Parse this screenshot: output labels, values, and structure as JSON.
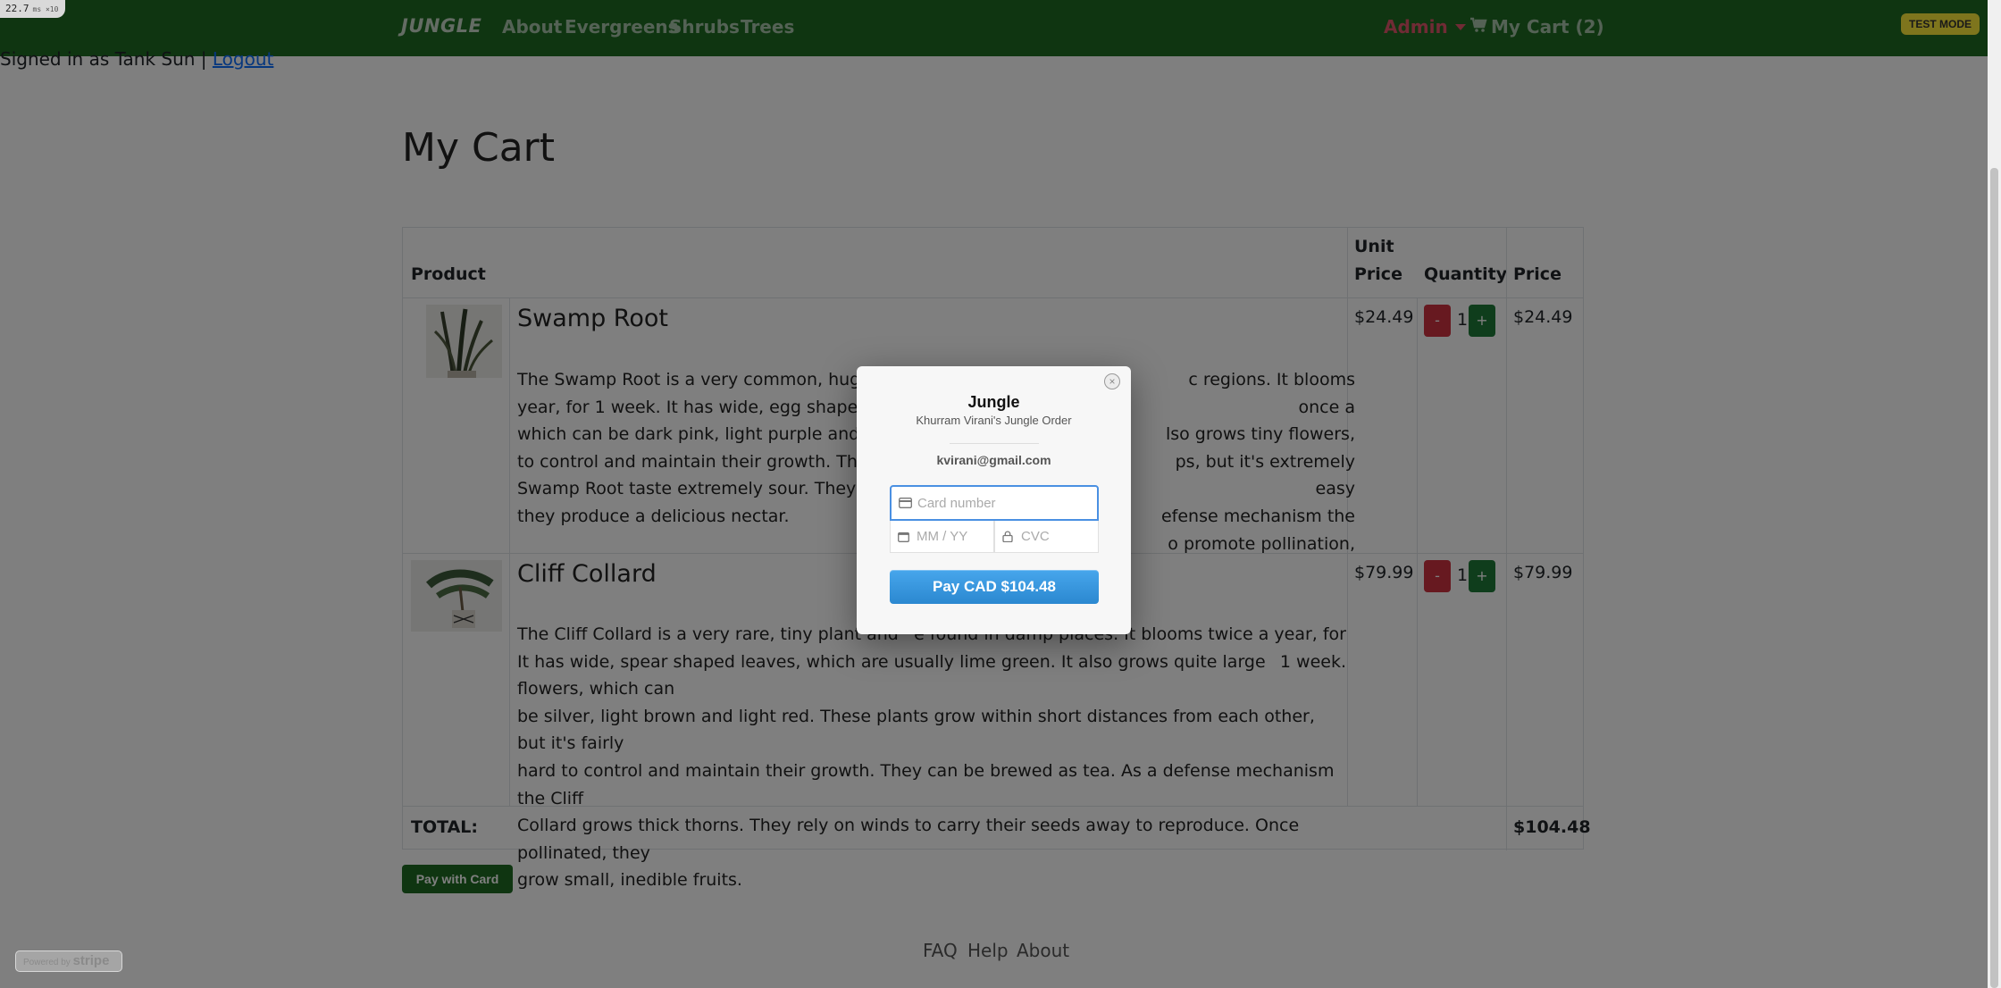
{
  "perf": {
    "value": "22.7",
    "unit": "ms",
    "mult": "×10"
  },
  "nav": {
    "brand": "JUNGLE",
    "links": [
      "About",
      "Evergreens",
      "Shrubs",
      "Trees"
    ],
    "admin": "Admin",
    "cart": "My Cart (2)"
  },
  "test_mode": "TEST MODE",
  "auth": {
    "signed_in": "Signed in as Tank Sun |",
    "logout": "Logout"
  },
  "page_title": "My Cart",
  "table": {
    "headers": {
      "product": "Product",
      "unit_price_1": "Unit",
      "unit_price_2": "Price",
      "quantity": "Quantity",
      "price": "Price"
    },
    "rows": [
      {
        "name": "Swamp Root",
        "description": "The Swamp Root is a very common, huge pla[...]c regions. It blooms once a year, for 1 week. It has wide, egg shaped leave[...]so grows tiny flowers, which can be dark pink, light purple and dark[...]ps, but it's extremely easy to control and maintain their growth. They ca[...]efense mechanism the Swamp Root taste extremely sour. They rely o[...]o promote pollination, they produce a delicious nectar.",
        "lines": [
          "The Swamp Root is a very common, huge pla",
          "year, for 1 week. It has wide, egg shaped leave",
          "which can be dark pink, light purple and dark",
          "to control and maintain their growth. They ca",
          "Swamp Root taste extremely sour. They rely o",
          "they produce a delicious nectar."
        ],
        "lines_right": [
          "c regions. It blooms once a",
          "lso grows tiny flowers,",
          "ps, but it's extremely easy",
          "efense mechanism the",
          "o promote pollination,",
          ""
        ],
        "unit_price": "$24.49",
        "quantity": "1",
        "price": "$24.49"
      },
      {
        "name": "Cliff Collard",
        "lines": [
          "The Cliff Collard is a very rare, tiny plant and",
          "It has wide, spear shaped leaves, which are usually lime green. It also grows quite large flowers, which can",
          "be silver, light brown and light red. These plants grow within short distances from each other, but it's fairly",
          "hard to control and maintain their growth. They can be brewed as tea. As a defense mechanism the Cliff",
          "Collard grows thick thorns. They rely on winds to carry their seeds away to reproduce. Once pollinated, they",
          "grow small, inedible fruits."
        ],
        "lines_right": [
          "e found in damp places. It blooms twice a year, for 1 week."
        ],
        "unit_price": "$79.99",
        "quantity": "1",
        "price": "$79.99"
      }
    ],
    "qty_minus": "-",
    "qty_plus": "+",
    "total_label": "TOTAL:",
    "total_value": "$104.48"
  },
  "pay_with_card": "Pay with Card",
  "footer": [
    "FAQ",
    "Help",
    "About"
  ],
  "powered": {
    "prefix": "Powered by",
    "brand": "stripe"
  },
  "modal": {
    "title": "Jungle",
    "subtitle": "Khurram Virani's Jungle Order",
    "email": "kvirani@gmail.com",
    "card_placeholder": "Card number",
    "exp_placeholder": "MM / YY",
    "cvc_placeholder": "CVC",
    "pay_button": "Pay CAD $104.48",
    "close": "×"
  }
}
